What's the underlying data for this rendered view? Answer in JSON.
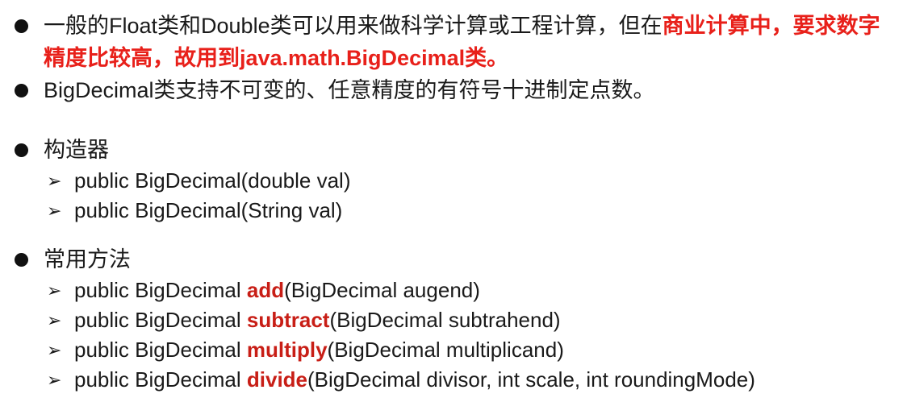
{
  "slide": {
    "intro": {
      "plain": "一般的Float类和Double类可以用来做科学计算或工程计算，但在",
      "highlight": "商业计算中，要求数字精度比较高，故用到java.math.BigDecimal类。"
    },
    "description": "BigDecimal类支持不可变的、任意精度的有符号十进制定点数。",
    "constructors": {
      "heading": "构造器",
      "items": [
        "public BigDecimal(double val)",
        "public BigDecimal(String val)"
      ]
    },
    "methods": {
      "heading": "常用方法",
      "items": [
        {
          "prefix": "public BigDecimal ",
          "name": "add",
          "params": "(BigDecimal augend)"
        },
        {
          "prefix": "public BigDecimal ",
          "name": "subtract",
          "params": "(BigDecimal subtrahend)"
        },
        {
          "prefix": "public BigDecimal ",
          "name": "multiply",
          "params": "(BigDecimal multiplicand)"
        },
        {
          "prefix": "public BigDecimal ",
          "name": "divide",
          "params": "(BigDecimal divisor, int scale, int roundingMode)"
        }
      ]
    },
    "icons": {
      "bullet": "filled-circle-bullet-icon",
      "sub_bullet": "arrow-bullet-icon"
    },
    "colors": {
      "highlight": "#e8201a",
      "method_name": "#c81e16",
      "text": "#1a1a1a",
      "background": "#ffffff"
    }
  }
}
